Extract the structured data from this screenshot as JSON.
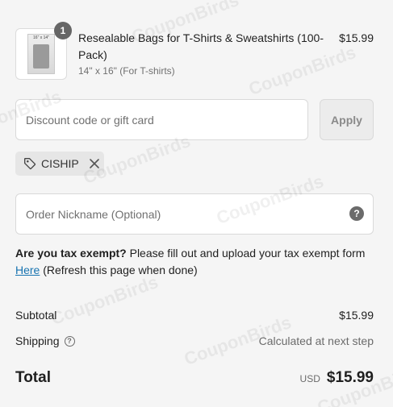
{
  "watermark": "CouponBirds",
  "product": {
    "thumbnail_caption": "16\" x 14\"",
    "quantity": "1",
    "name": "Resealable Bags for T-Shirts & Sweatshirts (100-Pack)",
    "variant": "14\" x 16\" (For T-shirts)",
    "price": "$15.99"
  },
  "discount": {
    "placeholder": "Discount code or gift card",
    "apply_label": "Apply",
    "applied_code": "CISHIP"
  },
  "nickname": {
    "placeholder": "Order Nickname (Optional)",
    "help_icon": "?"
  },
  "tax": {
    "question": "Are you tax exempt?",
    "text": " Please fill out and upload your tax exempt form ",
    "link": "Here",
    "suffix": " (Refresh this page when done)"
  },
  "summary": {
    "subtotal_label": "Subtotal",
    "subtotal_value": "$15.99",
    "shipping_label": "Shipping",
    "shipping_help_icon": "?",
    "shipping_value": "Calculated at next step",
    "total_label": "Total",
    "total_currency": "USD",
    "total_value": "$15.99"
  },
  "icons": {
    "tag": "tag-icon",
    "remove": "close-icon",
    "help": "question-circle-icon"
  },
  "colors": {
    "link": "#1773b0",
    "badge": "#666666"
  }
}
